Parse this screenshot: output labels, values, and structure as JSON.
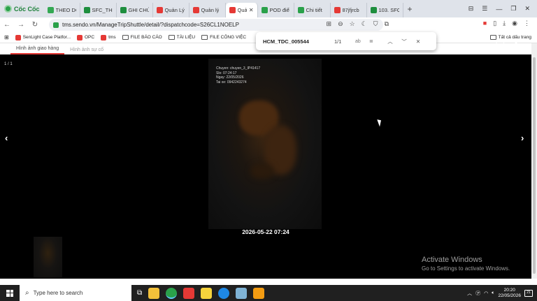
{
  "browser": {
    "brand": "Cốc Cốc",
    "tabs": [
      {
        "label": "THEO DÕ",
        "icon": "google-drive-icon",
        "color": "#34a853"
      },
      {
        "label": "SFC_THE",
        "icon": "sheets-icon",
        "color": "#1e8e3e"
      },
      {
        "label": "GHI CHÚ",
        "icon": "sheets-icon",
        "color": "#1e8e3e"
      },
      {
        "label": "Quản Lý",
        "icon": "sendo-icon",
        "color": "#e53935"
      },
      {
        "label": "Quản lý",
        "icon": "sendo-icon",
        "color": "#e53935"
      },
      {
        "label": "Quả",
        "icon": "sendo-icon",
        "color": "#e53935"
      },
      {
        "label": "POD điể",
        "icon": "globe-icon",
        "color": "#2aa14a"
      },
      {
        "label": "Chi tiết",
        "icon": "globe-icon",
        "color": "#2aa14a"
      },
      {
        "label": "87jfjrcb",
        "icon": "sendo-icon",
        "color": "#e53935"
      },
      {
        "label": "103. SFC",
        "icon": "sheets-icon",
        "color": "#1e8e3e"
      }
    ],
    "url": "tms.sendo.vn/ManageTripShuttle/detail/?dispatchcode=S26CL1NOELP"
  },
  "bookmarks": {
    "items": [
      {
        "label": "SenLight Case Platfor...",
        "kind": "sendo"
      },
      {
        "label": "OPC",
        "kind": "sendo"
      },
      {
        "label": "tms",
        "kind": "sendo"
      },
      {
        "label": "FILE BÁO CÁO",
        "kind": "folder"
      },
      {
        "label": "TÀI LIỆU",
        "kind": "folder"
      },
      {
        "label": "FILE CÔNG VIỆC",
        "kind": "folder"
      }
    ],
    "all_bookmarks": "Tất cả dấu trang"
  },
  "find": {
    "query": "HCM_TDC_005544",
    "count": "1/1"
  },
  "viewer": {
    "tabs": [
      "Hình ảnh giao hàng",
      "Hình ảnh sự cố"
    ],
    "counter": "1 / 1",
    "photo_overlay": "Chuyen: chuyen_3_IP41417\nSlo: 07:24:17\nNgay: 22/05/2026\nTai xe: 0942243274",
    "caption": "2026-05-22 07:24"
  },
  "watermark": {
    "title": "Activate Windows",
    "subtitle": "Go to Settings to activate Windows."
  },
  "taskbar": {
    "search_placeholder": "Type here to search",
    "time": "20:20",
    "date": "22/05/2026",
    "notifications": "21"
  }
}
